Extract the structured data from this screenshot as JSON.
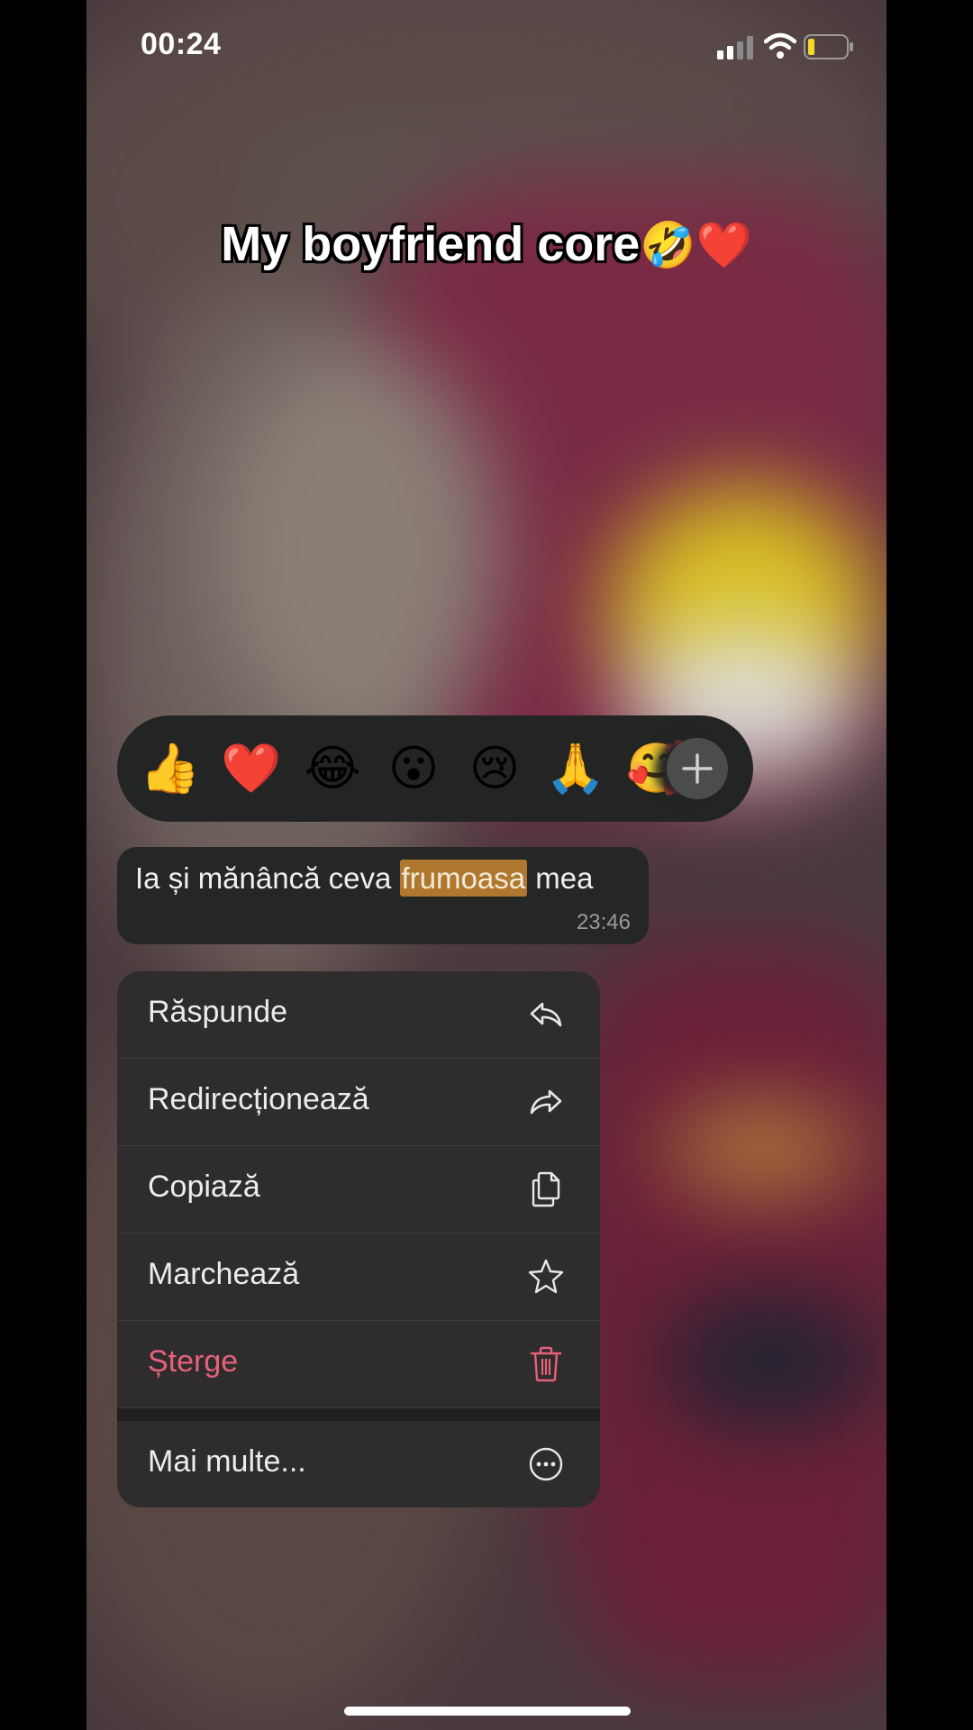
{
  "status_bar": {
    "time": "00:24",
    "icons": [
      "signal-icon",
      "wifi-icon",
      "battery-icon"
    ]
  },
  "caption": {
    "text": "My boyfriend core",
    "emoji": "🤣❤️"
  },
  "reactions": {
    "items": [
      {
        "name": "thumbs-up",
        "emoji": "👍"
      },
      {
        "name": "heart",
        "emoji": "❤️"
      },
      {
        "name": "tears-of-joy",
        "emoji": "😂"
      },
      {
        "name": "surprised",
        "emoji": "😮"
      },
      {
        "name": "crying",
        "emoji": "😢"
      },
      {
        "name": "folded-hands",
        "emoji": "🙏"
      },
      {
        "name": "heart-eyes",
        "emoji": "🥰"
      }
    ],
    "more_icon": "plus-icon"
  },
  "message": {
    "text_before": "Ia și mănâncă ceva ",
    "text_highlight": "frumoasa",
    "text_after": " mea",
    "time": "23:46"
  },
  "menu": {
    "items": [
      {
        "label": "Răspunde",
        "icon": "reply-icon"
      },
      {
        "label": "Redirecționează",
        "icon": "forward-icon"
      },
      {
        "label": "Copiază",
        "icon": "copy-icon"
      },
      {
        "label": "Marchează",
        "icon": "star-icon"
      },
      {
        "label": "Șterge",
        "icon": "trash-icon",
        "color": "#e5627a"
      }
    ],
    "more": {
      "label": "Mai multe...",
      "icon": "more-circle-icon"
    }
  }
}
